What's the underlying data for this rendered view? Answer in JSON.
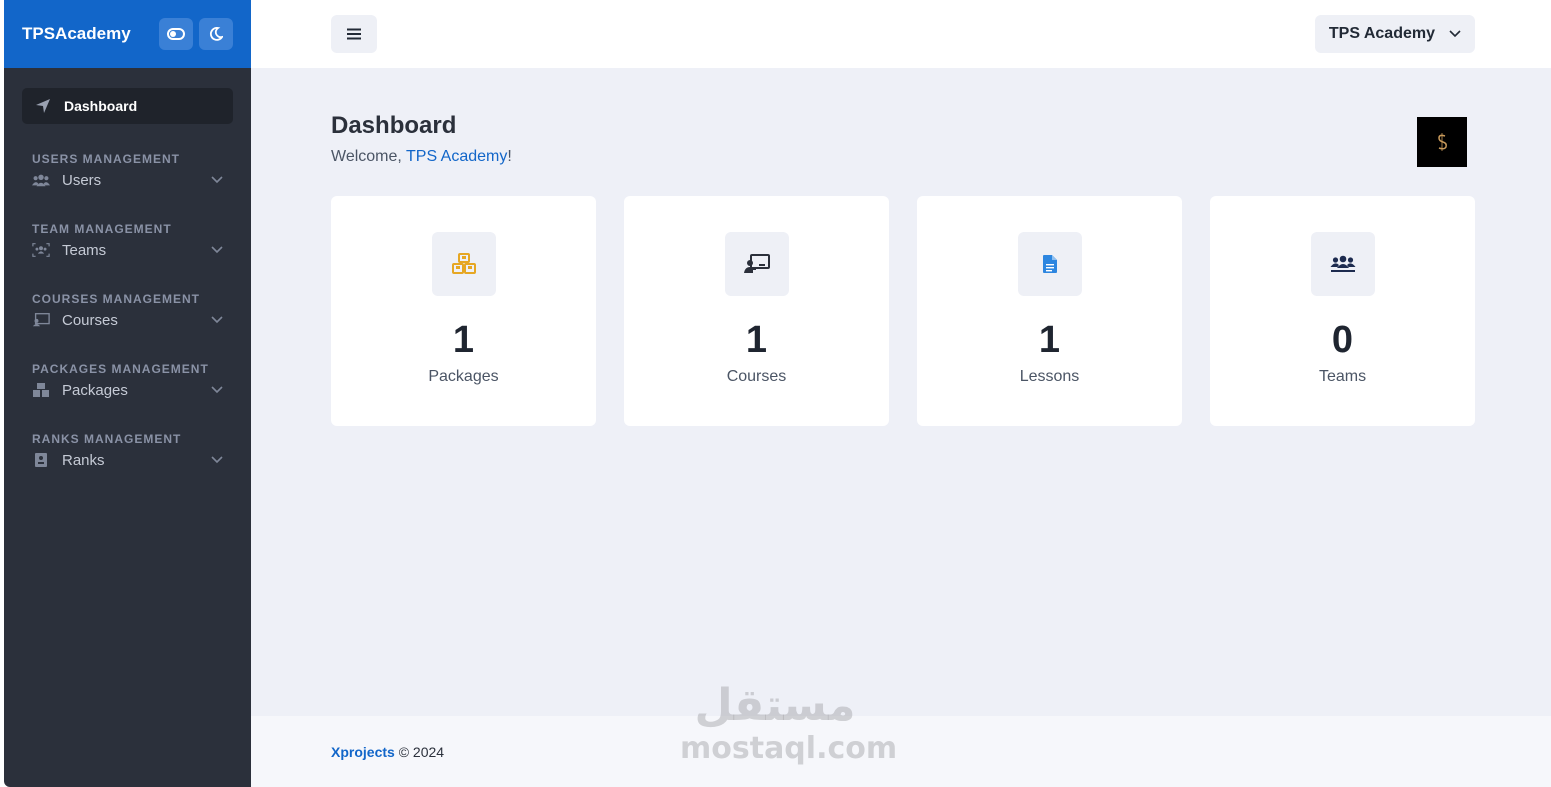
{
  "sidebar": {
    "brand": "TPSAcademy",
    "active_item": "Dashboard",
    "sections": [
      {
        "title": "USERS MANAGEMENT",
        "item": "Users",
        "icon": "users-icon"
      },
      {
        "title": "TEAM MANAGEMENT",
        "item": "Teams",
        "icon": "team-icon"
      },
      {
        "title": "COURSES MANAGEMENT",
        "item": "Courses",
        "icon": "chalkboard-icon"
      },
      {
        "title": "PACKAGES MANAGEMENT",
        "item": "Packages",
        "icon": "cubes-icon"
      },
      {
        "title": "RANKS MANAGEMENT",
        "item": "Ranks",
        "icon": "id-badge-icon"
      }
    ]
  },
  "topbar": {
    "account_name": "TPS Academy"
  },
  "page": {
    "title": "Dashboard",
    "welcome_prefix": "Welcome, ",
    "welcome_name": "TPS Academy",
    "welcome_suffix": "!"
  },
  "cards": [
    {
      "value": "1",
      "label": "Packages",
      "icon": "cubes-icon",
      "color": "#e6a723"
    },
    {
      "value": "1",
      "label": "Courses",
      "icon": "chalkboard-teacher-icon",
      "color": "#2b303b"
    },
    {
      "value": "1",
      "label": "Lessons",
      "icon": "file-icon",
      "color": "#2d86e0"
    },
    {
      "value": "0",
      "label": "Teams",
      "icon": "users-icon",
      "color": "#1d2b4f"
    }
  ],
  "footer": {
    "link": "Xprojects",
    "text": " © 2024"
  },
  "watermark": {
    "arabic": "مستقل",
    "latin": "mostaql.com"
  },
  "colors": {
    "sidebar_bg": "#2b303b",
    "brand_bg": "#1266c9",
    "main_bg": "#eef0f7",
    "accent": "#1266c9"
  }
}
